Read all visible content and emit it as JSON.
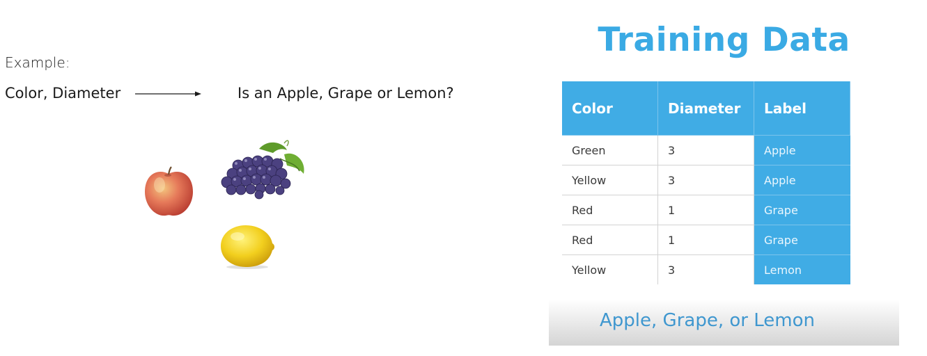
{
  "left": {
    "example_label": "Example:",
    "inputs_text": "Color, Diameter",
    "question_text": "Is an Apple, Grape or Lemon?",
    "arrow_icon": "right-arrow-icon"
  },
  "fruits": [
    "apple",
    "grape",
    "lemon"
  ],
  "slide": {
    "title": "Training Data",
    "columns": [
      "Color",
      "Diameter",
      "Label"
    ],
    "rows": [
      [
        "Green",
        "3",
        "Apple"
      ],
      [
        "Yellow",
        "3",
        "Apple"
      ],
      [
        "Red",
        "1",
        "Grape"
      ],
      [
        "Red",
        "1",
        "Grape"
      ],
      [
        "Yellow",
        "3",
        "Lemon"
      ]
    ],
    "caption": "Apple, Grape, or Lemon",
    "accent_color": "#40ace5",
    "title_color": "#3aaae4"
  }
}
